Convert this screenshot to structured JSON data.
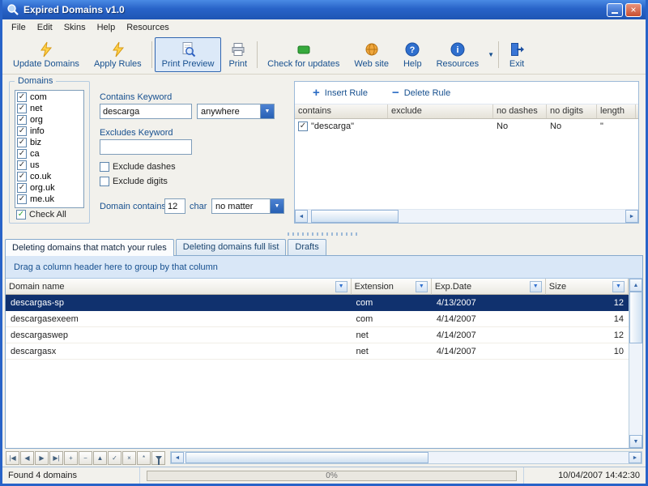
{
  "window": {
    "title": "Expired Domains v1.0"
  },
  "menubar": {
    "items": [
      "File",
      "Edit",
      "Skins",
      "Help",
      "Resources"
    ]
  },
  "toolbar": {
    "update_domains": "Update Domains",
    "apply_rules": "Apply Rules",
    "print_preview": "Print Preview",
    "print": "Print",
    "check_updates": "Check for updates",
    "web_site": "Web site",
    "help": "Help",
    "resources": "Resources",
    "exit": "Exit"
  },
  "domains": {
    "title": "Domains",
    "items": [
      "com",
      "net",
      "org",
      "info",
      "biz",
      "ca",
      "us",
      "co.uk",
      "org.uk",
      "me.uk"
    ],
    "check_all": "Check All"
  },
  "filters": {
    "contains_label": "Contains Keyword",
    "contains_value": "descarga",
    "position_value": "anywhere",
    "excludes_label": "Excludes Keyword",
    "excludes_value": "",
    "exclude_dashes": "Exclude dashes",
    "exclude_digits": "Exclude digits",
    "domain_contains_label": "Domain contains",
    "length_value": "12",
    "char_label": "char",
    "matter_value": "no matter"
  },
  "rules": {
    "insert_label": "Insert Rule",
    "delete_label": "Delete Rule",
    "columns": [
      "contains",
      "exclude",
      "no dashes",
      "no digits",
      "length"
    ],
    "row": {
      "contains": "\"descarga\"",
      "exclude": "",
      "no_dashes": "No",
      "no_digits": "No",
      "length": "\""
    }
  },
  "tabs": {
    "tab1": "Deleting domains that match your rules",
    "tab2": "Deleting domains full list",
    "tab3": "Drafts"
  },
  "grid": {
    "group_hint": "Drag a column header here to group by that column",
    "columns": [
      "Domain name",
      "Extension",
      "Exp.Date",
      "Size"
    ],
    "rows": [
      {
        "domain": "descargas-sp",
        "ext": "com",
        "date": "4/13/2007",
        "size": "12"
      },
      {
        "domain": "descargasexeem",
        "ext": "com",
        "date": "4/14/2007",
        "size": "14"
      },
      {
        "domain": "descargaswep",
        "ext": "net",
        "date": "4/14/2007",
        "size": "12"
      },
      {
        "domain": "descargasx",
        "ext": "net",
        "date": "4/14/2007",
        "size": "10"
      }
    ]
  },
  "navigator": {
    "buttons": [
      "|◀",
      "◀",
      "▶",
      "▶|",
      "+",
      "−",
      "▲",
      "✓",
      "×",
      "*"
    ]
  },
  "statusbar": {
    "found": "Found 4 domains",
    "progress": "0%",
    "datetime": "10/04/2007 14:42:30",
    "accent_color": "#2863c8",
    "selection_color": "#10316e"
  }
}
